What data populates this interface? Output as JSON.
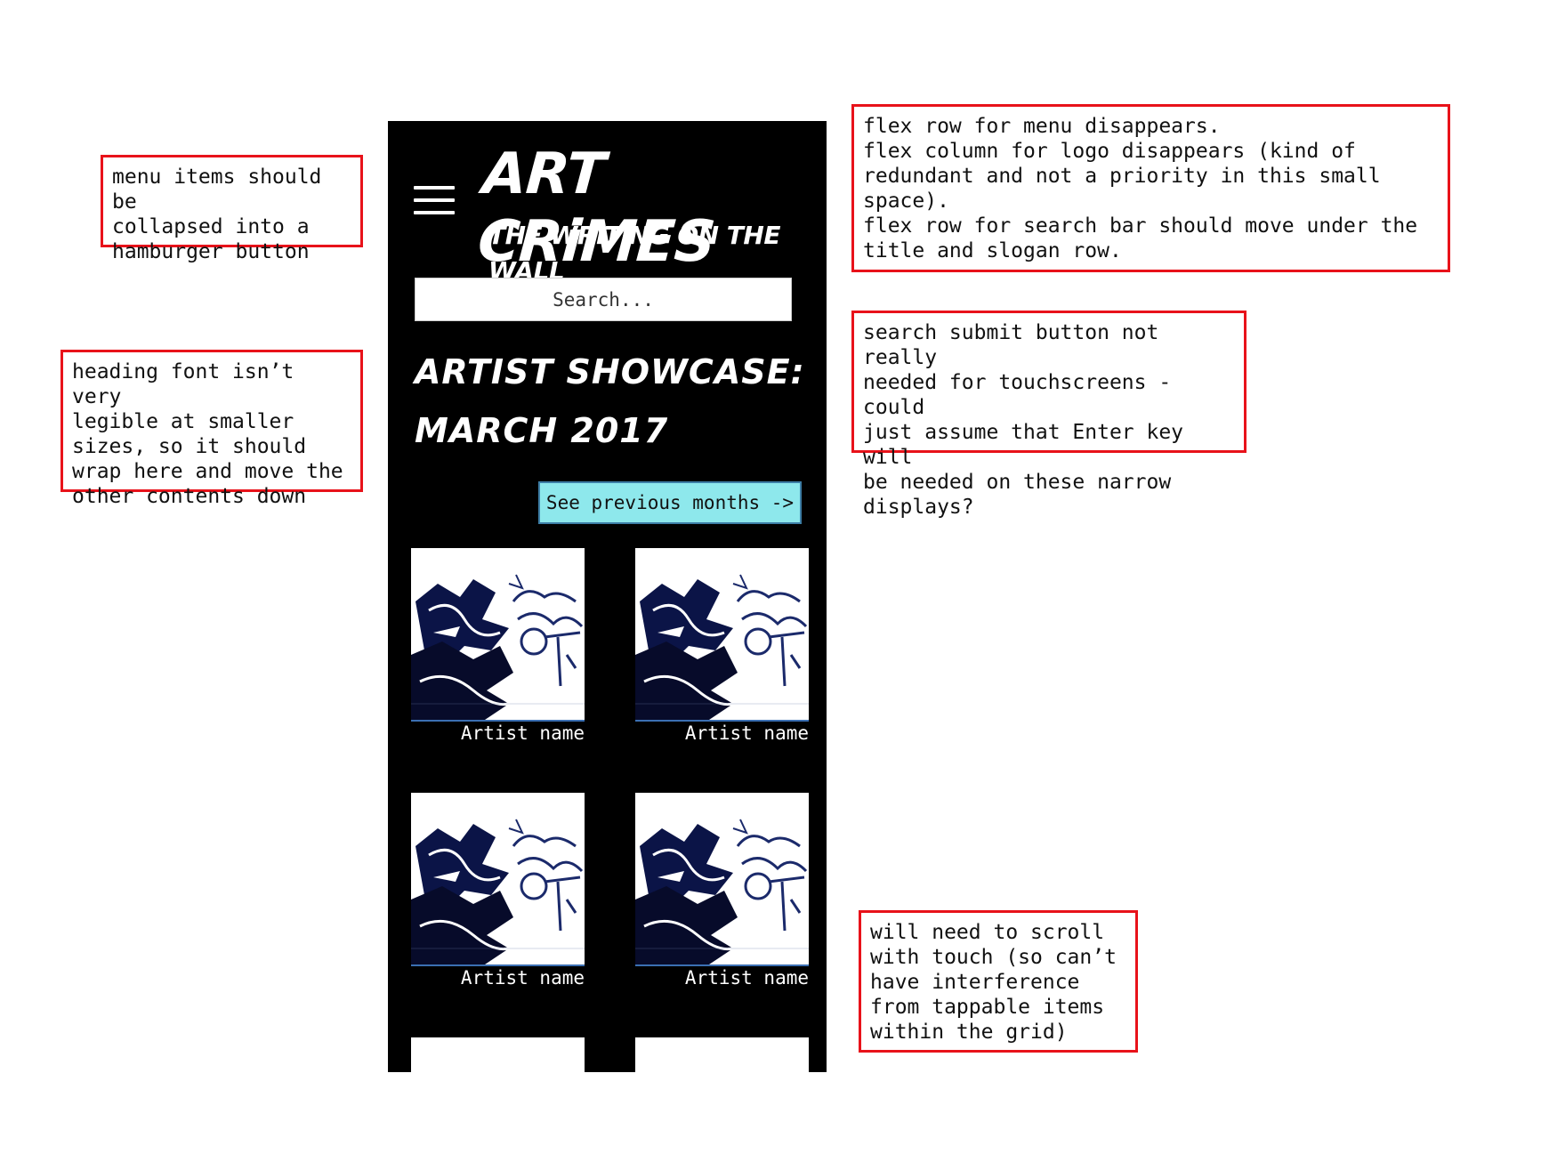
{
  "notes": {
    "menu": "menu items should be\ncollapsed into a\nhamburger button",
    "heading": "heading font isn’t very\nlegible at smaller\nsizes, so it should\nwrap here and move the\nother contents down",
    "flex": "flex row for menu disappears.\nflex column for logo disappears (kind of\nredundant and not a priority in this small\nspace).\nflex row for search bar should move under the\ntitle and slogan row.",
    "search": "search submit button not really\nneeded for touchscreens - could\njust assume that Enter key will\nbe needed on these narrow\ndisplays?",
    "scroll": "will need to scroll\nwith touch (so can’t\nhave interference\nfrom tappable items\nwithin the grid)"
  },
  "phone": {
    "logo": {
      "title": "ART CRiMES",
      "slogan": "THE WRiTiNG ON THE WALL"
    },
    "search": {
      "placeholder": "Search..."
    },
    "heading": {
      "line1": "ARTIST SHOWCASE:",
      "line2": "MARCH 2017"
    },
    "prev_button": "See previous months ->",
    "artists": [
      {
        "name": "Artist name"
      },
      {
        "name": "Artist name"
      },
      {
        "name": "Artist name"
      },
      {
        "name": "Artist name"
      }
    ]
  },
  "colors": {
    "annotation_border": "#e8121a",
    "button_bg": "#8ee8ec",
    "phone_bg": "#000000"
  }
}
